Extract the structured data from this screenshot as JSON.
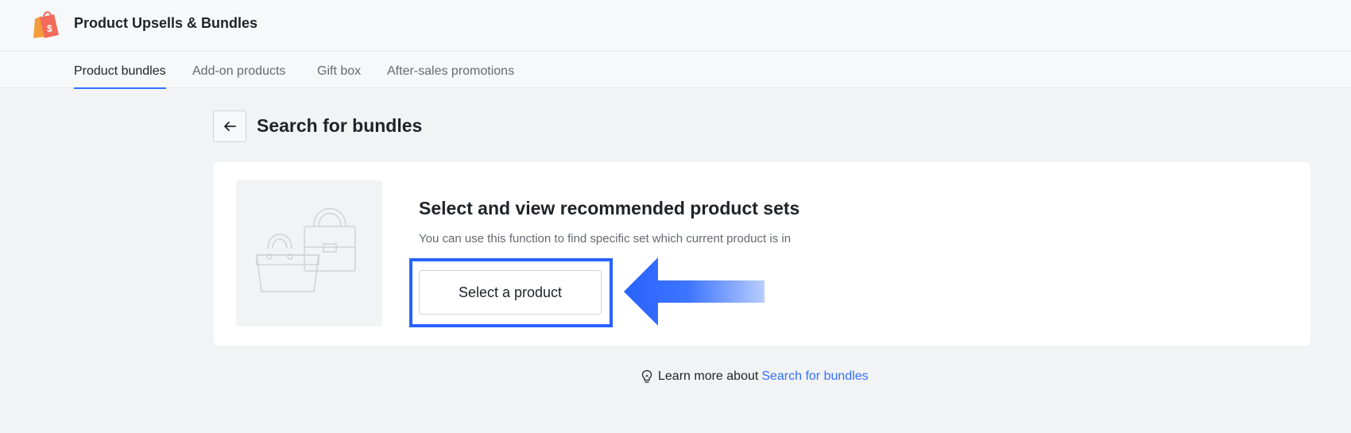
{
  "app": {
    "title": "Product Upsells & Bundles",
    "logo_icon": "shopping-bag-dollar-icon"
  },
  "tabs": [
    {
      "label": "Product bundles",
      "active": true
    },
    {
      "label": "Add-on products",
      "active": false
    },
    {
      "label": "Gift box",
      "active": false
    },
    {
      "label": "After-sales promotions",
      "active": false
    }
  ],
  "header": {
    "back_icon": "arrow-left-icon",
    "title": "Search for bundles"
  },
  "card": {
    "illustration_icon": "shopping-bags-icon",
    "title": "Select and view recommended product sets",
    "description": "You can use this function to find specific set which current product is in",
    "button_label": "Select a product"
  },
  "annotation": {
    "highlight_color": "#2962ff",
    "arrow_icon": "arrow-left-icon"
  },
  "footer": {
    "icon": "lightbulb-icon",
    "text": "Learn more about",
    "link": "Search for bundles"
  },
  "colors": {
    "accent": "#3370ff",
    "background": "#f2f3f5"
  }
}
